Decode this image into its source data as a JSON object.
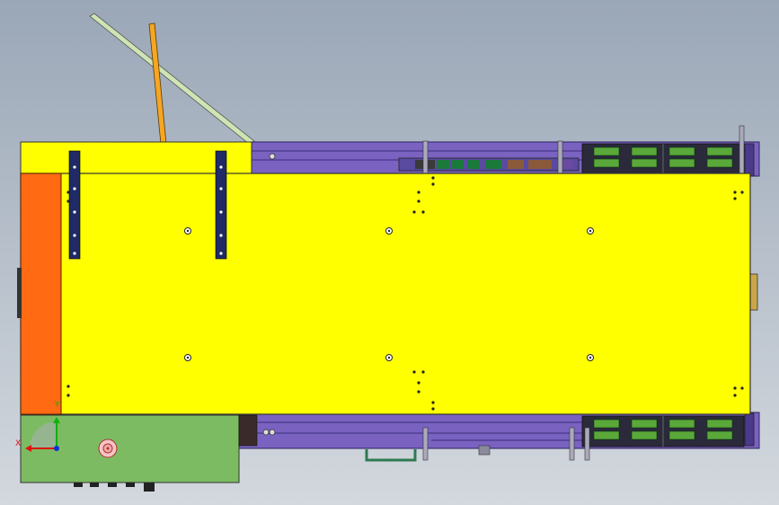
{
  "viewport": {
    "background_top": "#9aa7b7",
    "background_bottom": "#d3d8de"
  },
  "colors": {
    "plate_yellow": "#ffff00",
    "plate_edge": "#4a4a00",
    "frame_purple": "#7a62c0",
    "frame_purple_dark": "#4b3a8c",
    "orange_block": "#ff6a12",
    "green_block": "#7cbb62",
    "grip_green": "#5aa83a",
    "bar_navy": "#1f2a66",
    "rod_green": "#cfe4b4",
    "rod_orange": "#f5a623",
    "marker_pink": "#f3a7a7"
  },
  "icons": {
    "triad": "coordinate-triad-icon",
    "marker": "origin-marker-icon"
  },
  "triad": {
    "x_label": "X",
    "y_label": "Y"
  }
}
